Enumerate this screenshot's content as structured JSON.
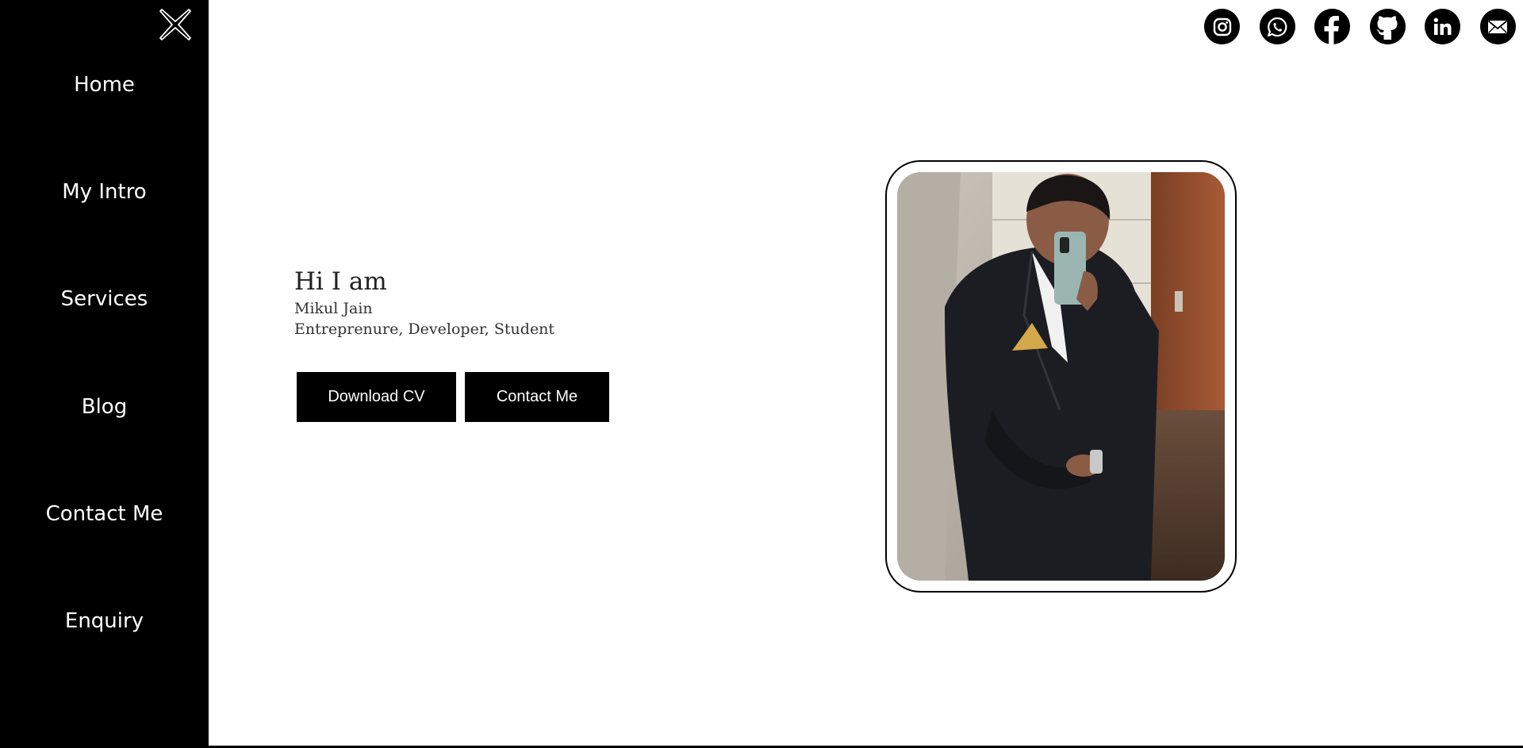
{
  "sidebar": {
    "close_icon": "close-x-icon",
    "items": [
      {
        "label": "Home"
      },
      {
        "label": "My Intro"
      },
      {
        "label": "Services"
      },
      {
        "label": "Blog"
      },
      {
        "label": "Contact Me"
      },
      {
        "label": "Enquiry"
      }
    ]
  },
  "social": [
    "instagram-icon",
    "whatsapp-icon",
    "facebook-icon",
    "github-icon",
    "linkedin-icon",
    "email-icon"
  ],
  "intro": {
    "greeting": "Hi I am",
    "name": "Mikul Jain",
    "roles": "Entreprenure, Developer, Student"
  },
  "buttons": {
    "download_cv": "Download CV",
    "contact_me": "Contact Me"
  },
  "colors": {
    "sidebar_bg": "#000000",
    "accent": "#000000",
    "text": "#ffffff"
  }
}
